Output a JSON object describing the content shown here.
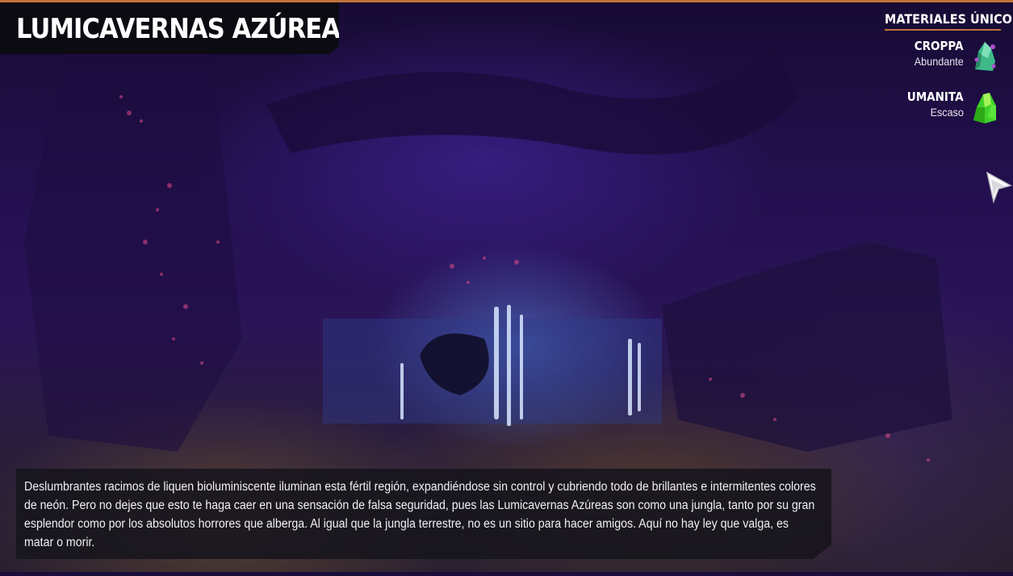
{
  "title": "LUMICAVERNAS AZÚREAS",
  "materials": {
    "header": "MATERIALES ÚNICOS",
    "items": [
      {
        "name": "CROPPA",
        "rarity": "Abundante",
        "icon": "croppa-crystal-icon"
      },
      {
        "name": "UMANITA",
        "rarity": "Escaso",
        "icon": "umanita-crystal-icon"
      }
    ]
  },
  "description": "Deslumbrantes racimos de liquen bioluminiscente iluminan esta fértil región, expandiéndose sin control y cubriendo todo de brillantes e intermitentes colores de neón. Pero no dejes que esto te haga caer en una sensación de falsa seguridad, pues las Lumicavernas Azúreas son como una jungla, tanto por su gran esplendor como por los absolutos horrores que alberga. Al igual que la jungla terrestre, no es un sitio para hacer amigos. Aquí no hay ley que valga, es matar o morir.",
  "colors": {
    "accent": "#c2733a",
    "panel": "#0c0b12",
    "text": "#ffffff"
  },
  "icons": {
    "cursor": "pointer-cursor-icon"
  }
}
